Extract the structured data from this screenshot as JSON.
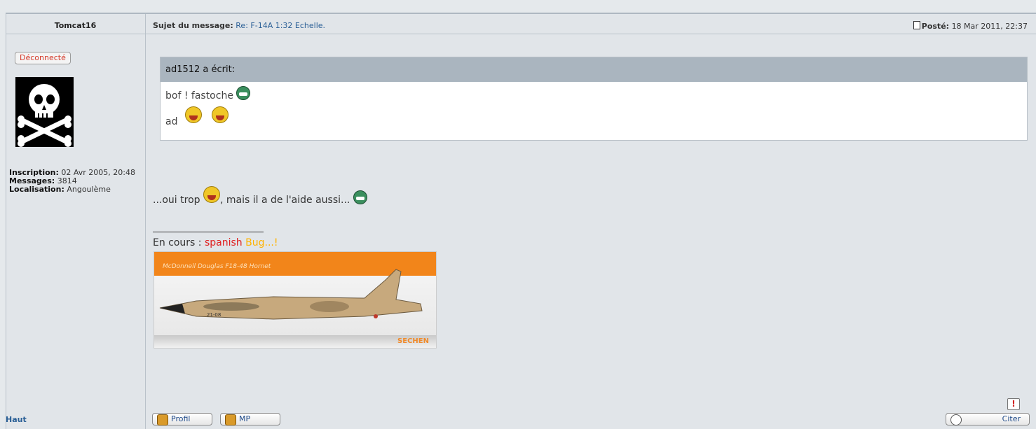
{
  "post": {
    "author": "Tomcat16",
    "subject_label": "Sujet du message:",
    "subject": "Re: F-14A 1:32 Echelle.",
    "posted_label": "Posté:",
    "posted_date": "18 Mar 2011, 22:37",
    "status_badge": "Déconnecté",
    "inscription_label": "Inscription:",
    "inscription_value": "02 Avr 2005, 20:48",
    "messages_label": "Messages:",
    "messages_value": "3814",
    "localisation_label": "Localisation:",
    "localisation_value": "Angoulème"
  },
  "quote": {
    "header": "ad1512 a écrit:",
    "line1": "bof ! fastoche",
    "line2": "ad"
  },
  "body": {
    "text_before": "...oui trop",
    "text_after": ", mais il a de l'aide aussi...",
    "signature_prefix": "En cours : ",
    "signature_red": "spanish",
    "signature_orange": " Bug...!",
    "image_title": "McDonnell Douglas F18-48 Hornet",
    "image_brand": "SECHEN"
  },
  "footer": {
    "haut": "Haut",
    "profil": "Profil",
    "mp": "MP",
    "citer": "Citer",
    "report": "!"
  },
  "colors": {
    "link": "#2a5f96",
    "quote_header_bg": "#aab5bf",
    "offline": "#d63a2a"
  },
  "icons": [
    "document-icon",
    "grin-green-smiley-icon",
    "laughing-smiley-icon",
    "rolling-eyes-smiley-icon",
    "report-icon",
    "profile-icon",
    "pm-icon",
    "quote-icon"
  ]
}
